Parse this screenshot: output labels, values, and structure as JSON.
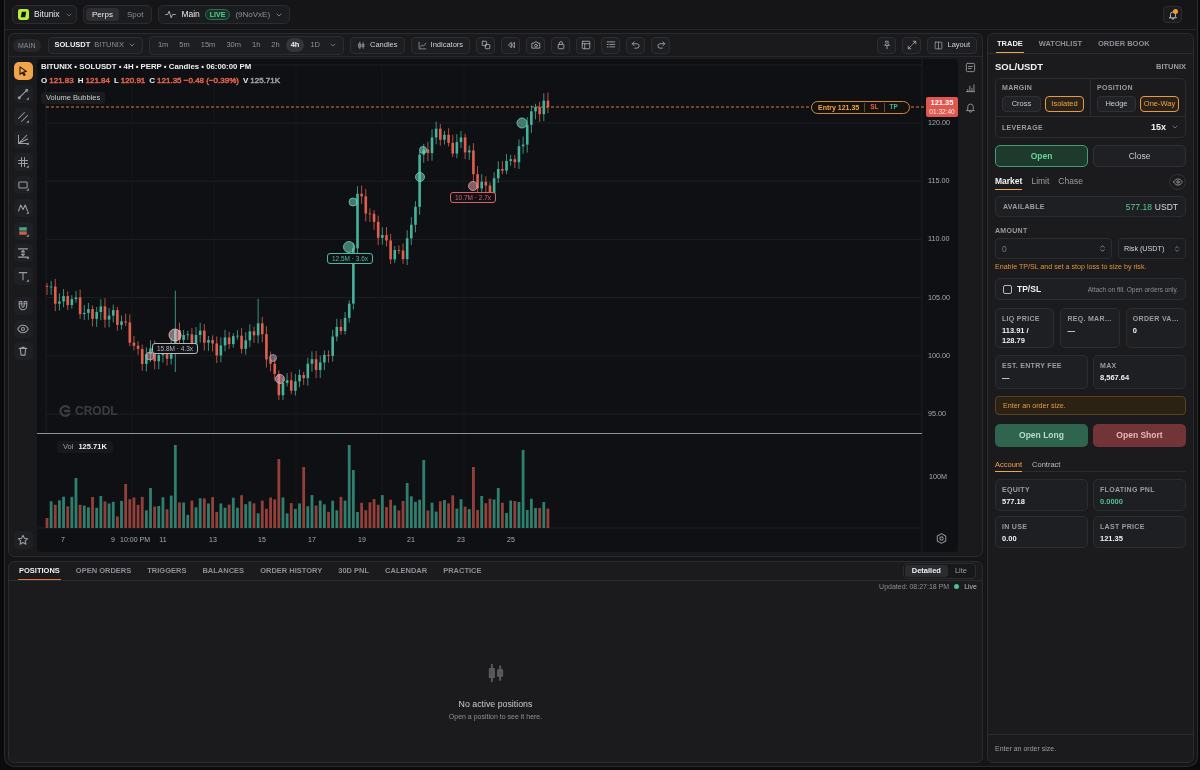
{
  "top_bar": {
    "brand": "Bitunix",
    "market_modes": [
      {
        "label": "Perps",
        "selected": true
      },
      {
        "label": "Spot",
        "selected": false
      }
    ],
    "account": {
      "name": "Main",
      "badge": "LIVE",
      "code": "(9NoVxE)"
    },
    "notifications": {
      "unread": true
    }
  },
  "chart_toolbar": {
    "layout_tag": "MAIN",
    "symbol": "SOLUSDT",
    "exchange": "BITUNIX",
    "timeframes": [
      {
        "label": "1m",
        "selected": false
      },
      {
        "label": "5m",
        "selected": false
      },
      {
        "label": "15m",
        "selected": false
      },
      {
        "label": "30m",
        "selected": false
      },
      {
        "label": "1h",
        "selected": false
      },
      {
        "label": "2h",
        "selected": false
      },
      {
        "label": "4h",
        "selected": true
      },
      {
        "label": "1D",
        "selected": false
      }
    ],
    "chart_type": "Candles",
    "indicators": "Indicators",
    "layout": "Layout"
  },
  "drawing_tools": [
    {
      "selected": true
    },
    {
      "selected": false
    },
    {
      "selected": false
    },
    {
      "selected": false
    },
    {
      "selected": false
    },
    {
      "selected": false
    },
    {
      "selected": false
    },
    {
      "selected": false
    },
    {
      "selected": false
    },
    {
      "selected": false
    },
    {
      "selected": false
    },
    {
      "selected": false
    },
    {
      "selected": false
    }
  ],
  "chart": {
    "title": "BITUNIX • SOLUSDT • 4H • PERP • Candles • 06:00:00 PM",
    "ohlc": [
      {
        "key": "O",
        "value": "121.83",
        "color": "#e0604f"
      },
      {
        "key": "H",
        "value": "121.84",
        "color": "#e0604f"
      },
      {
        "key": "L",
        "value": "120.91",
        "color": "#e0604f"
      },
      {
        "key": "C",
        "value": "121.35 −0.48 (−0.39%)",
        "color": "#e0604f"
      },
      {
        "key": "V",
        "value": "125.71K",
        "color": "#9a9ea6"
      }
    ],
    "indicator": "Volume Bubbles",
    "bubble_labels": [
      {
        "text": "15.8M · 4.3x",
        "color": "#b4b8bf"
      },
      {
        "text": "12.5M · 3.6x",
        "color": "#4fb8a0"
      },
      {
        "text": "10.7M · 2.7x",
        "color": "#d9606a"
      }
    ],
    "entry_marker": {
      "label": "Entry 121.35",
      "stop_loss": "SL",
      "take_profit": "TP"
    },
    "last_price": {
      "price": "121.35",
      "countdown": "01:32:40"
    },
    "price_axis": [
      "120.00",
      "115.00",
      "110.00",
      "105.00",
      "100.00",
      "95.00"
    ],
    "logo": "CRODL",
    "volume": {
      "label": "Vol",
      "value": "125.71K",
      "axis": [
        "100M"
      ]
    },
    "time_axis": [
      "7",
      "9",
      "10:00 PM",
      "11",
      "13",
      "15",
      "17",
      "19",
      "21",
      "23",
      "25"
    ]
  },
  "positions_panel": {
    "tabs": [
      {
        "label": "POSITIONS",
        "selected": true
      },
      {
        "label": "OPEN ORDERS",
        "selected": false
      },
      {
        "label": "TRIGGERS",
        "selected": false
      },
      {
        "label": "BALANCES",
        "selected": false
      },
      {
        "label": "ORDER HISTORY",
        "selected": false
      },
      {
        "label": "30D PNL",
        "selected": false
      },
      {
        "label": "CALENDAR",
        "selected": false
      },
      {
        "label": "PRACTICE",
        "selected": false
      }
    ],
    "views": [
      {
        "label": "Detailed",
        "selected": true
      },
      {
        "label": "Lite",
        "selected": false
      }
    ],
    "updated": "Updated: 08:27:18 PM",
    "status": "Live",
    "empty_title": "No active positions",
    "empty_hint": "Open a position to see it here."
  },
  "trade_panel": {
    "tabs": [
      {
        "label": "TRADE",
        "selected": true
      },
      {
        "label": "WATCHLIST",
        "selected": false
      },
      {
        "label": "ORDER BOOK",
        "selected": false
      }
    ],
    "pair": "SOL/USDT",
    "exchange": "BITUNIX",
    "margin": {
      "label": "MARGIN",
      "options": [
        {
          "label": "Cross",
          "selected": false
        },
        {
          "label": "Isolated",
          "selected": true
        }
      ]
    },
    "position": {
      "label": "POSITION",
      "options": [
        {
          "label": "Hedge",
          "selected": false
        },
        {
          "label": "One-Way",
          "selected": true
        }
      ]
    },
    "leverage": {
      "label": "LEVERAGE",
      "value": "15x"
    },
    "sides": [
      {
        "label": "Open",
        "selected": true
      },
      {
        "label": "Close",
        "selected": false
      }
    ],
    "order_types": [
      {
        "label": "Market",
        "selected": true
      },
      {
        "label": "Limit",
        "selected": false
      },
      {
        "label": "Chase",
        "selected": false
      }
    ],
    "available": {
      "label": "AVAILABLE",
      "value": "577.18",
      "unit": "USDT"
    },
    "amount": {
      "label": "AMOUNT",
      "placeholder": "0",
      "unit_select": "Risk (USDT)"
    },
    "risk_hint": "Enable TP/SL and set a stop loss to size by risk.",
    "tpsl": {
      "label": "TP/SL",
      "checked": false,
      "hint": "Attach on fill. Open orders only."
    },
    "stats": [
      {
        "label": "LIQ PRICE",
        "value": "113.91 / 128.79"
      },
      {
        "label": "REQ. MAR…",
        "value": "—"
      },
      {
        "label": "ORDER VA…",
        "value": "0"
      }
    ],
    "estimates": [
      {
        "label": "EST. ENTRY FEE",
        "value": "—"
      },
      {
        "label": "MAX",
        "value": "8,567.64"
      }
    ],
    "warning": "Enter an order size.",
    "actions": [
      {
        "label": "Open Long",
        "kind": "long",
        "disabled": true
      },
      {
        "label": "Open Short",
        "kind": "short",
        "disabled": true
      }
    ],
    "info_tabs": [
      {
        "label": "Account",
        "selected": true
      },
      {
        "label": "Contract",
        "selected": false
      }
    ],
    "account": [
      {
        "label": "EQUITY",
        "value": "577.18",
        "color": "#f0f0f2"
      },
      {
        "label": "FLOATING PNL",
        "value": "0.0000",
        "color": "#4fc08f"
      },
      {
        "label": "IN USE",
        "value": "0.00",
        "color": "#f0f0f2"
      },
      {
        "label": "LAST PRICE",
        "value": "121.35",
        "color": "#f0f0f2"
      }
    ],
    "footer": "Enter an order size."
  }
}
